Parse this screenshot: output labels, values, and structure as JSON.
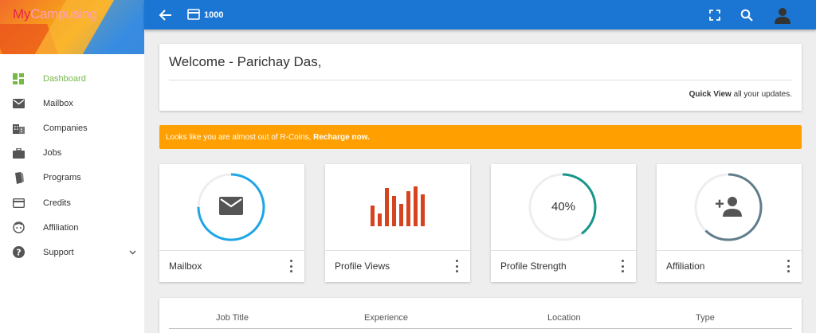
{
  "app": {
    "logo_text_a": "My",
    "logo_text_b": "Campusing",
    "brand_colors": {
      "topbar": "#1a76d2",
      "accent_green": "#76b947",
      "alert": "#ff9f00"
    }
  },
  "topbar": {
    "coins": "1000",
    "icons": [
      "back-arrow-icon",
      "credit-card-icon",
      "fullscreen-icon",
      "search-icon",
      "user-avatar-icon"
    ]
  },
  "sidebar": {
    "items": [
      {
        "label": "Dashboard",
        "icon": "dashboard-icon",
        "active": true
      },
      {
        "label": "Mailbox",
        "icon": "mail-icon"
      },
      {
        "label": "Companies",
        "icon": "building-icon"
      },
      {
        "label": "Jobs",
        "icon": "briefcase-icon"
      },
      {
        "label": "Programs",
        "icon": "book-icon"
      },
      {
        "label": "Credits",
        "icon": "credit-card-icon"
      },
      {
        "label": "Affiliation",
        "icon": "face-icon"
      },
      {
        "label": "Support",
        "icon": "help-icon",
        "has_submenu": true
      }
    ]
  },
  "welcome": {
    "title": "Welcome - Parichay Das,",
    "quick_bold": "Quick View",
    "quick_rest": " all your updates."
  },
  "alert": {
    "text": "Looks like you are almost out of R-Coins, ",
    "link": "Recharge now."
  },
  "stats": [
    {
      "title": "Mailbox",
      "icon": "mail-icon",
      "ring_color": "#1ea6e6",
      "ring_fraction": 0.75
    },
    {
      "title": "Profile Views",
      "icon": "bar-chart-icon",
      "bar_color": "#d6441f"
    },
    {
      "title": "Profile Strength",
      "value": "40%",
      "ring_color": "#16968a",
      "ring_fraction": 0.4
    },
    {
      "title": "Affiliation",
      "icon": "add-person-icon",
      "ring_color": "#607d8b",
      "ring_fraction": 0.62
    }
  ],
  "jobs_table": {
    "columns": [
      "Job Title",
      "Experience",
      "Location",
      "Type"
    ]
  }
}
